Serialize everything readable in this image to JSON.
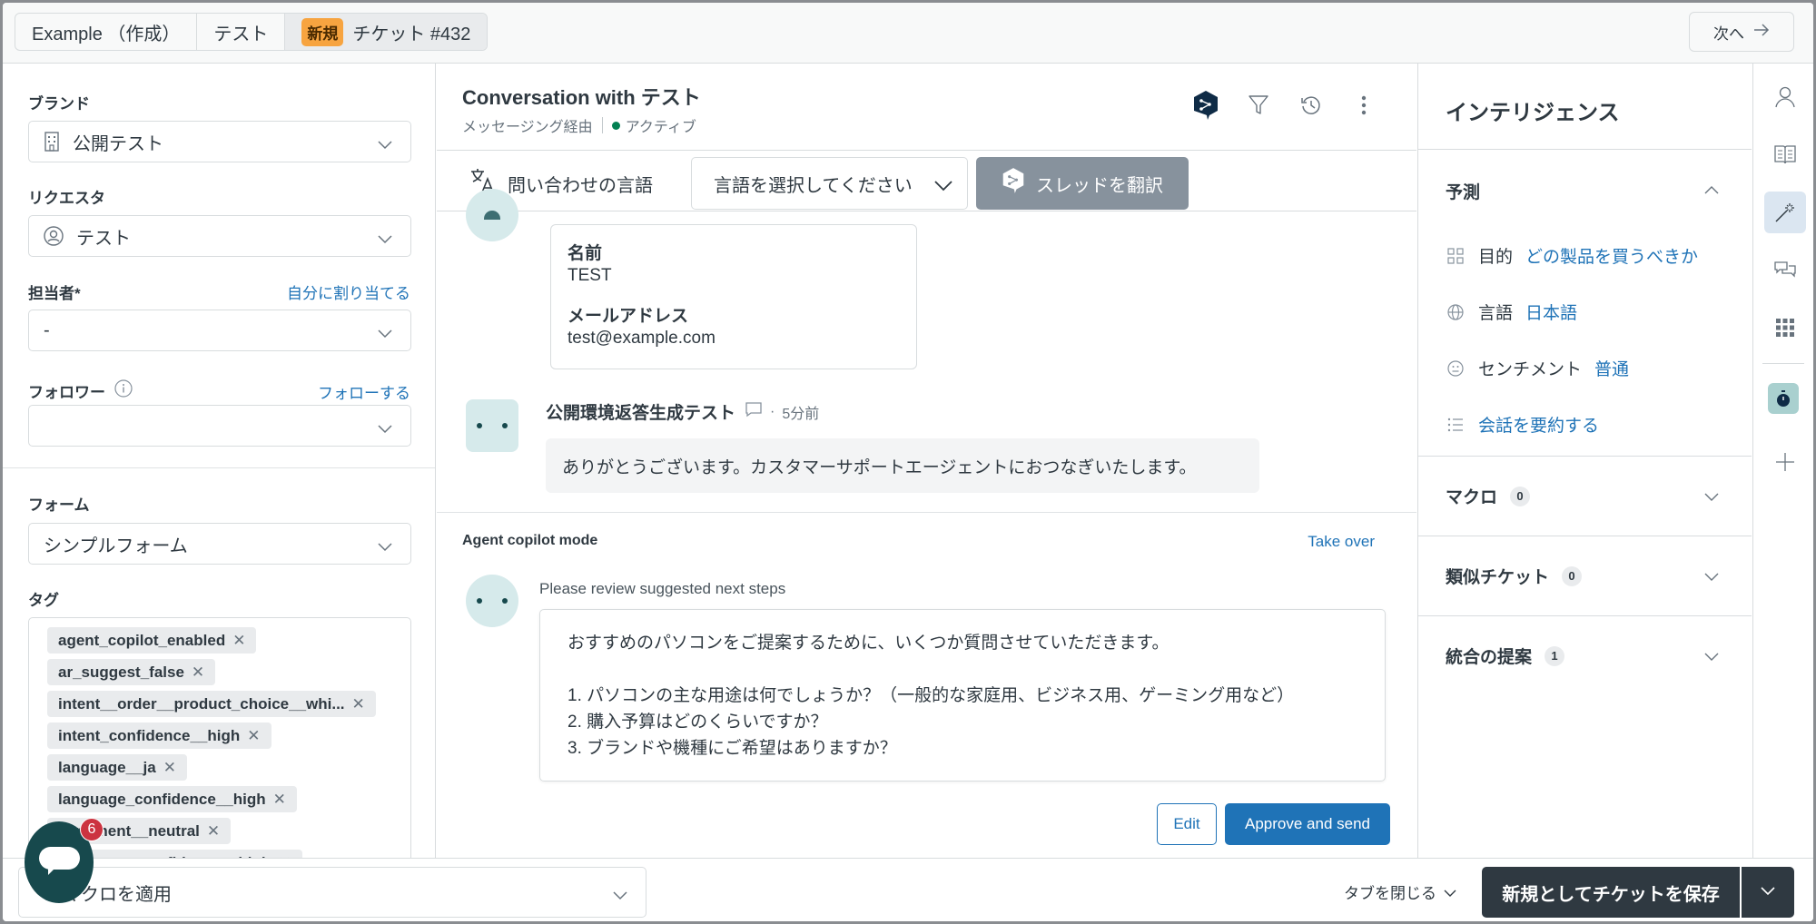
{
  "topbar": {
    "tabs": [
      {
        "label": "Example （作成）"
      },
      {
        "label": "テスト"
      },
      {
        "badge": "新規",
        "label": "チケット #432"
      }
    ],
    "next_label": "次へ"
  },
  "left": {
    "brand": {
      "label": "ブランド",
      "value": "公開テスト"
    },
    "requester": {
      "label": "リクエスタ",
      "value": "テスト"
    },
    "assignee": {
      "label": "担当者*",
      "link": "自分に割り当てる",
      "value": "-"
    },
    "followers": {
      "label": "フォロワー",
      "link": "フォローする",
      "value": ""
    },
    "form": {
      "label": "フォーム",
      "value": "シンプルフォーム"
    },
    "tags": {
      "label": "タグ",
      "items": [
        "agent_copilot_enabled",
        "ar_suggest_false",
        "intent__order__product_choice__whi...",
        "intent_confidence__high",
        "language__ja",
        "language_confidence__high",
        "sentiment__neutral",
        "sentiment_confidence__high"
      ]
    }
  },
  "conversation": {
    "title": "Conversation with テスト",
    "channel": "メッセージング経由",
    "status": "アクティブ",
    "status_color": "#038153",
    "language_label": "問い合わせの言語",
    "language_select_placeholder": "言語を選択してください",
    "translate_button": "スレッドを翻訳",
    "form_card": [
      {
        "key": "名前",
        "value": "TEST"
      },
      {
        "key": "メールアドレス",
        "value": "test@example.com"
      }
    ],
    "bot_message": {
      "author": "公開環境返答生成テスト",
      "time": "5分前",
      "text": "ありがとうございます。カスタマーサポートエージェントにおつなぎいたします。"
    },
    "copilot": {
      "title": "Agent copilot mode",
      "take_over": "Take over",
      "review_text": "Please review suggested next steps",
      "suggestion_lines": [
        "おすすめのパソコンをご提案するために、いくつか質問させていただきます。",
        "",
        "1. パソコンの主な用途は何でしょうか？（一般的な家庭用、ビジネス用、ゲーミング用など）",
        "2. 購入予算はどのくらいですか？",
        "3. ブランドや機種にご希望はありますか？"
      ],
      "edit_button": "Edit",
      "approve_button": "Approve and send"
    }
  },
  "intelligence": {
    "title": "インテリジェンス",
    "prediction": {
      "title": "予測",
      "items": [
        {
          "icon": "intent-grid-icon",
          "label": "目的",
          "value": "どの製品を買うべきか"
        },
        {
          "icon": "globe-icon",
          "label": "言語",
          "value": "日本語"
        },
        {
          "icon": "neutral-face-icon",
          "label": "センチメント",
          "value": "普通"
        }
      ],
      "summarize_link": "会話を要約する"
    },
    "sections": [
      {
        "title": "マクロ",
        "count": "0"
      },
      {
        "title": "類似チケット",
        "count": "0"
      },
      {
        "title": "統合の提案",
        "count": "1"
      }
    ]
  },
  "bottombar": {
    "macro_placeholder": "マクロを適用",
    "close_tab": "タブを閉じる",
    "save_button": "新規としてチケットを保存"
  },
  "launcher": {
    "badge_count": "6"
  },
  "colors": {
    "accent": "#1f73b7",
    "dark": "#2f3941",
    "badge_new": "#f7a440"
  }
}
